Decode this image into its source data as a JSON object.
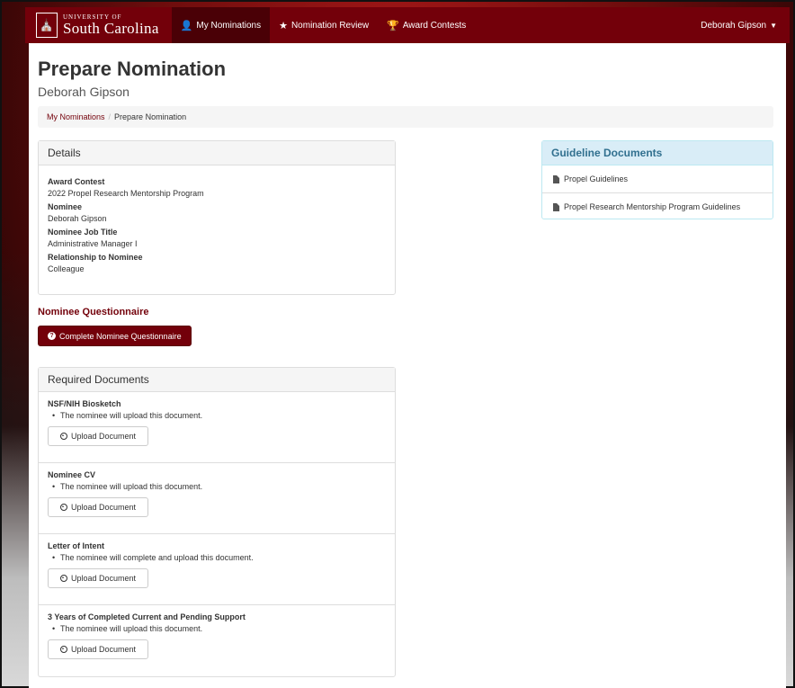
{
  "nav": {
    "brand_top": "University of",
    "brand_main": "South Carolina",
    "items": [
      {
        "label": "My Nominations",
        "icon": "user-icon"
      },
      {
        "label": "Nomination Review",
        "icon": "star-icon"
      },
      {
        "label": "Award Contests",
        "icon": "trophy-icon"
      }
    ],
    "user": "Deborah Gipson"
  },
  "page": {
    "title": "Prepare Nomination",
    "subtitle": "Deborah Gipson"
  },
  "breadcrumb": {
    "link": "My Nominations",
    "separator": "/",
    "current": "Prepare Nomination"
  },
  "details": {
    "heading": "Details",
    "fields": [
      {
        "label": "Award Contest",
        "value": "2022 Propel Research Mentorship Program"
      },
      {
        "label": "Nominee",
        "value": "Deborah Gipson"
      },
      {
        "label": "Nominee Job Title",
        "value": "Administrative Manager I"
      },
      {
        "label": "Relationship to Nominee",
        "value": "Colleague"
      }
    ]
  },
  "guidelines": {
    "heading": "Guideline Documents",
    "items": [
      "Propel Guidelines",
      "Propel Research Mentorship Program Guidelines"
    ]
  },
  "questionnaire": {
    "title": "Nominee Questionnaire",
    "button": "Complete Nominee Questionnaire"
  },
  "required_docs": {
    "heading": "Required Documents",
    "upload_label": "Upload Document",
    "items": [
      {
        "name": "NSF/NIH Biosketch",
        "note": "The nominee will upload this document."
      },
      {
        "name": "Nominee CV",
        "note": "The nominee will upload this document."
      },
      {
        "name": "Letter of Intent",
        "note": "The nominee will complete and upload this document."
      },
      {
        "name": "3 Years of Completed Current and Pending Support",
        "note": "The nominee will upload this document."
      }
    ]
  },
  "colors": {
    "brand": "#73000a",
    "info_bg": "#d9edf7",
    "info_text": "#31708f"
  }
}
